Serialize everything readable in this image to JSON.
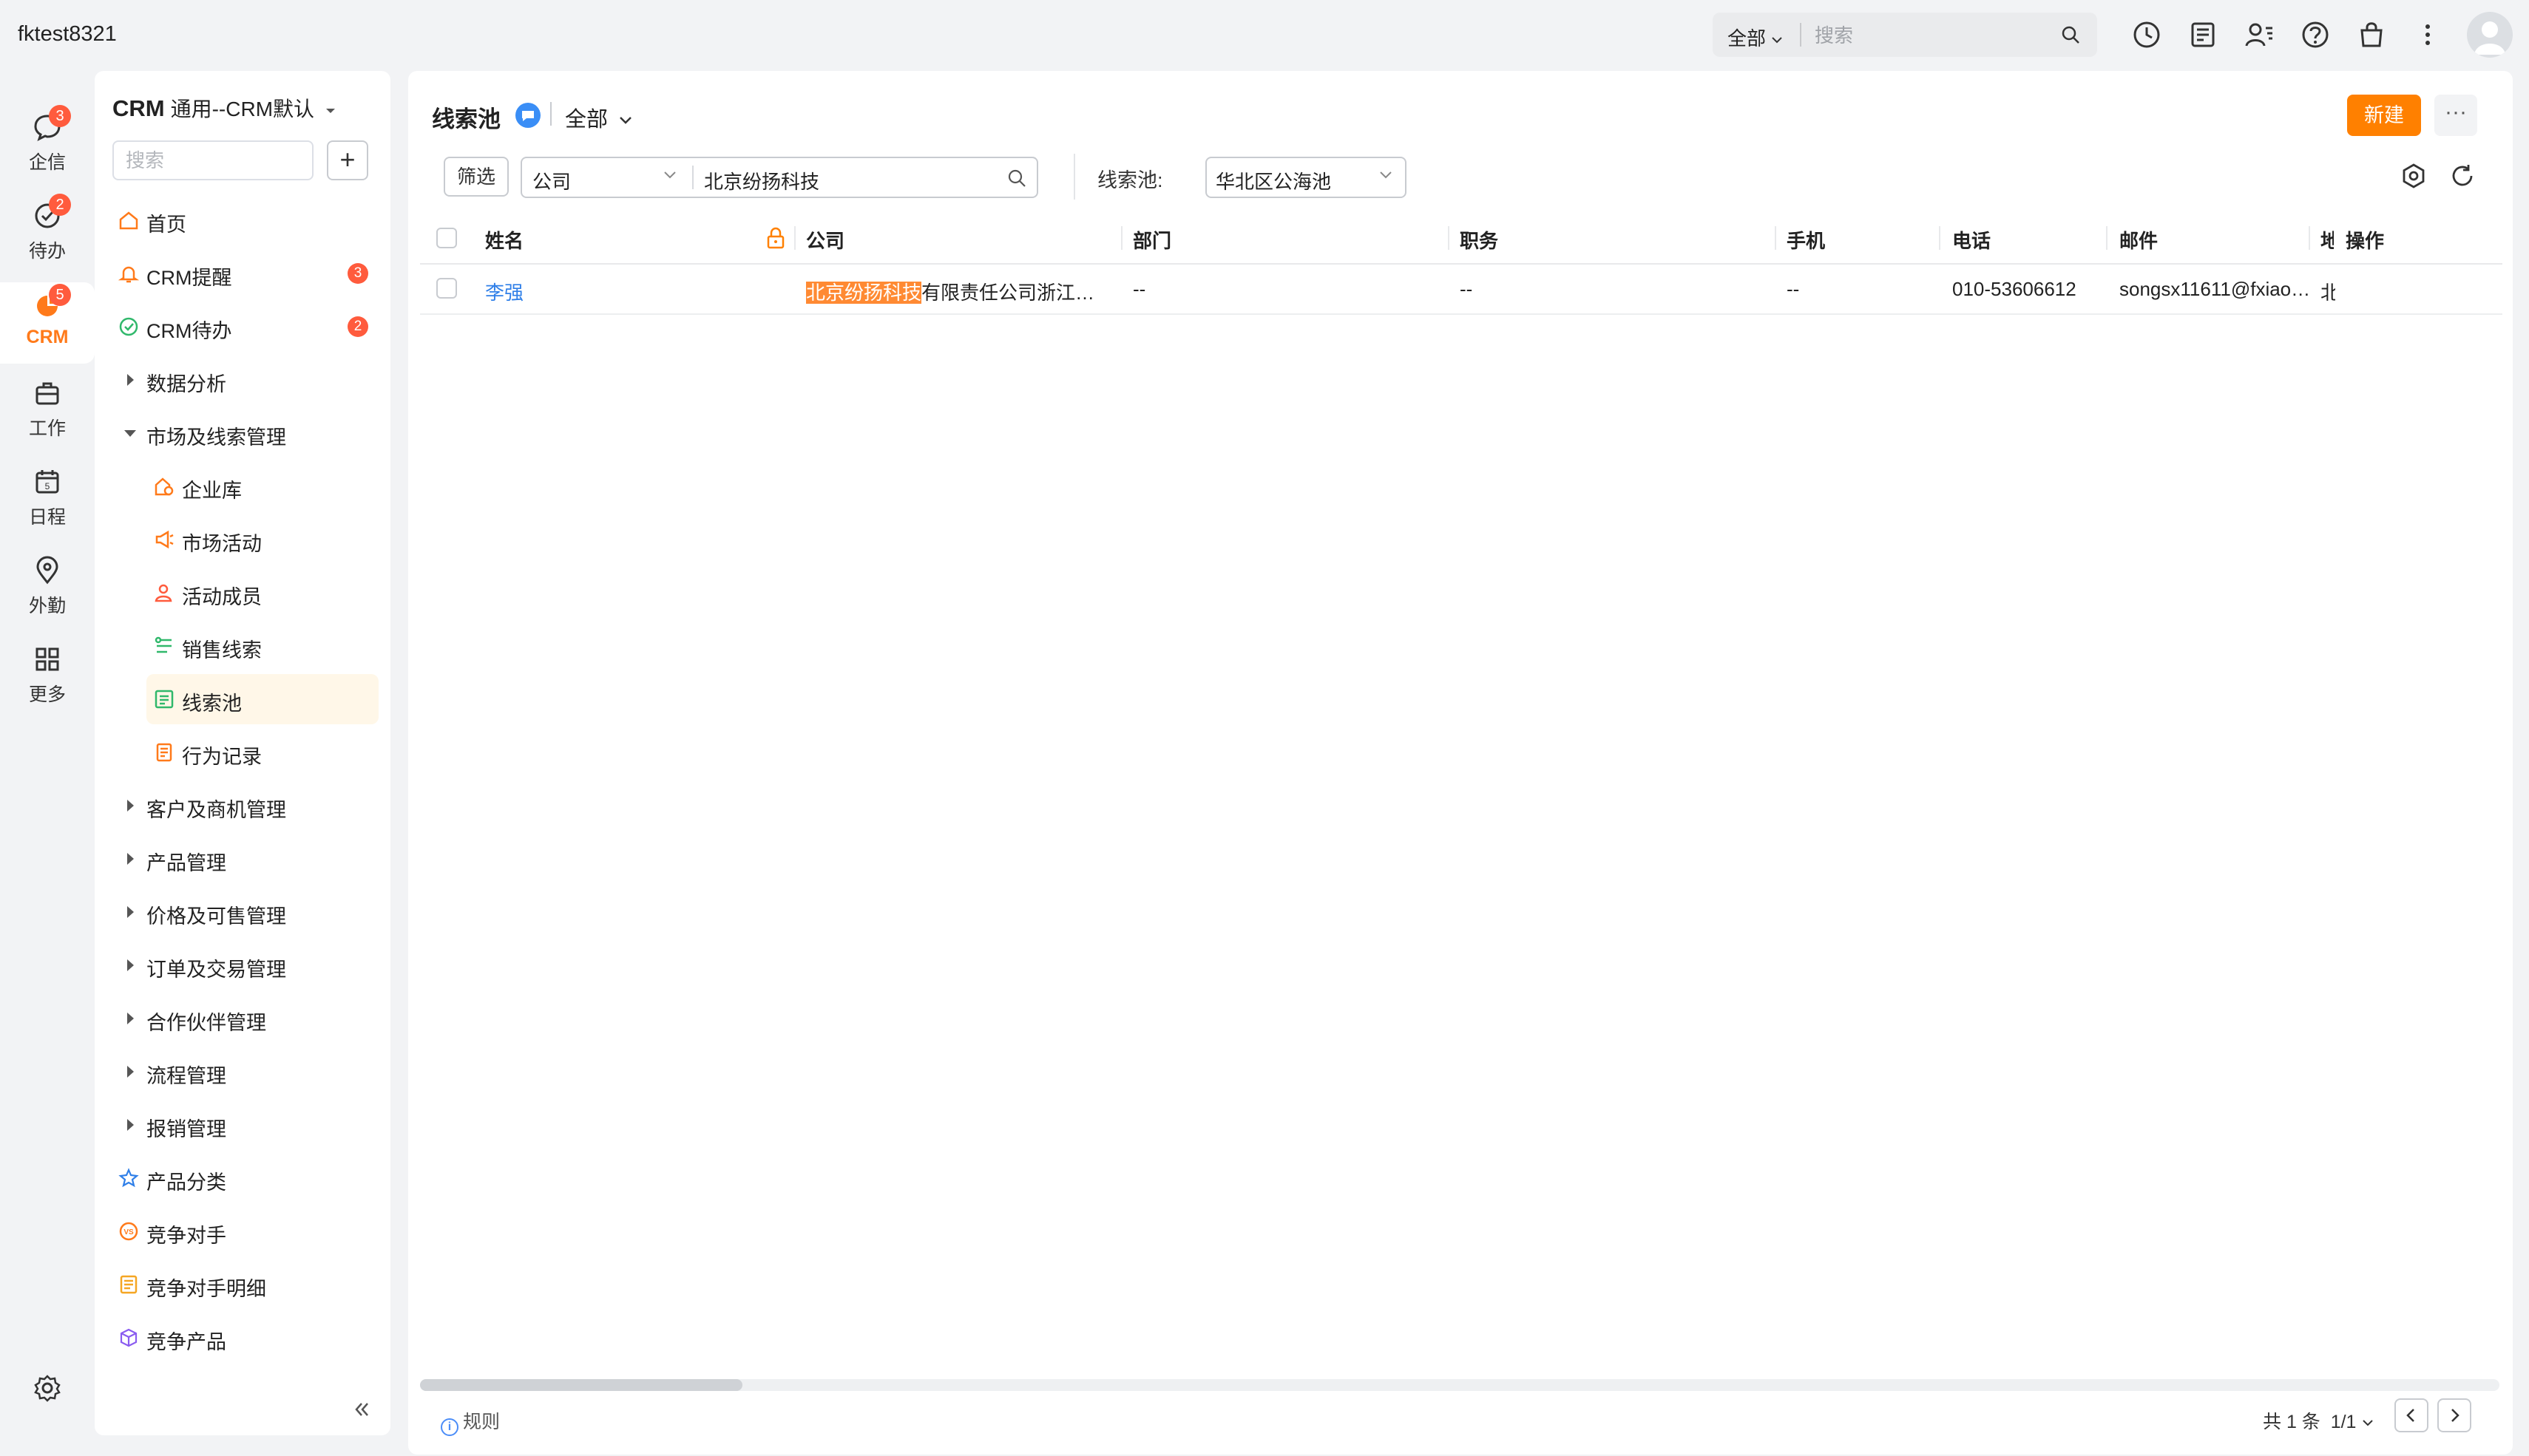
{
  "topbar": {
    "username": "fktest8321",
    "search_scope": "全部",
    "search_placeholder": "搜索",
    "icons": [
      "history-icon",
      "notes-icon",
      "contacts-icon",
      "help-icon",
      "shop-icon",
      "more-vert-icon"
    ]
  },
  "rail": {
    "items": [
      {
        "label": "企信",
        "badge": "3",
        "icon": "chat-icon"
      },
      {
        "label": "待办",
        "badge": "2",
        "icon": "todo-icon"
      },
      {
        "label": "CRM",
        "badge": "5",
        "icon": "crm-icon",
        "active": true
      },
      {
        "label": "工作",
        "icon": "briefcase-icon"
      },
      {
        "label": "日程",
        "icon": "calendar-icon"
      },
      {
        "label": "外勤",
        "icon": "location-icon"
      },
      {
        "label": "更多",
        "icon": "grid-icon"
      }
    ],
    "settings_icon": "gear-icon"
  },
  "nav": {
    "app": "CRM",
    "view": "通用--CRM默认",
    "search_placeholder": "搜索",
    "add_label": "+",
    "items": [
      {
        "label": "首页",
        "icon": "home-icon"
      },
      {
        "label": "CRM提醒",
        "icon": "bell-icon",
        "badge": "3"
      },
      {
        "label": "CRM待办",
        "icon": "check-circle-icon",
        "badge": "2"
      },
      {
        "label": "数据分析",
        "group": "collapsed"
      },
      {
        "label": "市场及线索管理",
        "group": "expanded"
      },
      {
        "label": "企业库",
        "icon": "enterprise-icon",
        "sub": true
      },
      {
        "label": "市场活动",
        "icon": "megaphone-icon",
        "sub": true
      },
      {
        "label": "活动成员",
        "icon": "member-icon",
        "sub": true
      },
      {
        "label": "销售线索",
        "icon": "leads-icon",
        "sub": true
      },
      {
        "label": "线索池",
        "icon": "pool-icon",
        "sub": true,
        "active": true
      },
      {
        "label": "行为记录",
        "icon": "record-icon",
        "sub": true
      },
      {
        "label": "客户及商机管理",
        "group": "collapsed"
      },
      {
        "label": "产品管理",
        "group": "collapsed"
      },
      {
        "label": "价格及可售管理",
        "group": "collapsed"
      },
      {
        "label": "订单及交易管理",
        "group": "collapsed"
      },
      {
        "label": "合作伙伴管理",
        "group": "collapsed"
      },
      {
        "label": "流程管理",
        "group": "collapsed"
      },
      {
        "label": "报销管理",
        "group": "collapsed"
      },
      {
        "label": "产品分类",
        "icon": "category-icon"
      },
      {
        "label": "竞争对手",
        "icon": "vs-icon"
      },
      {
        "label": "竞争对手明细",
        "icon": "detail-icon"
      },
      {
        "label": "竞争产品",
        "icon": "cube-icon"
      }
    ]
  },
  "main": {
    "title": "线索池",
    "scope": "全部",
    "new_label": "新建",
    "more_label": "···",
    "filter_label": "筛选",
    "search_field": "公司",
    "search_value": "北京纷扬科技",
    "pool_label": "线索池:",
    "pool_value": "华北区公海池",
    "columns": [
      "姓名",
      "公司",
      "部门",
      "职务",
      "手机",
      "电话",
      "邮件",
      "地",
      "操作"
    ],
    "rows": [
      {
        "name": "李强",
        "company_highlight": "北京纷扬科技",
        "company_rest": "有限责任公司浙江…",
        "department": "--",
        "position": "--",
        "mobile": "--",
        "phone": "010-53606612",
        "email": "songsx11611@fxiao…",
        "address": "北"
      }
    ],
    "rule_label": "规则",
    "pager": {
      "total": "共 1 条",
      "page": "1/1"
    }
  },
  "colors": {
    "accent": "#ff8000",
    "badge": "#ff5b3d",
    "link": "#2f7fe8",
    "active_bg": "#fff7e8"
  }
}
